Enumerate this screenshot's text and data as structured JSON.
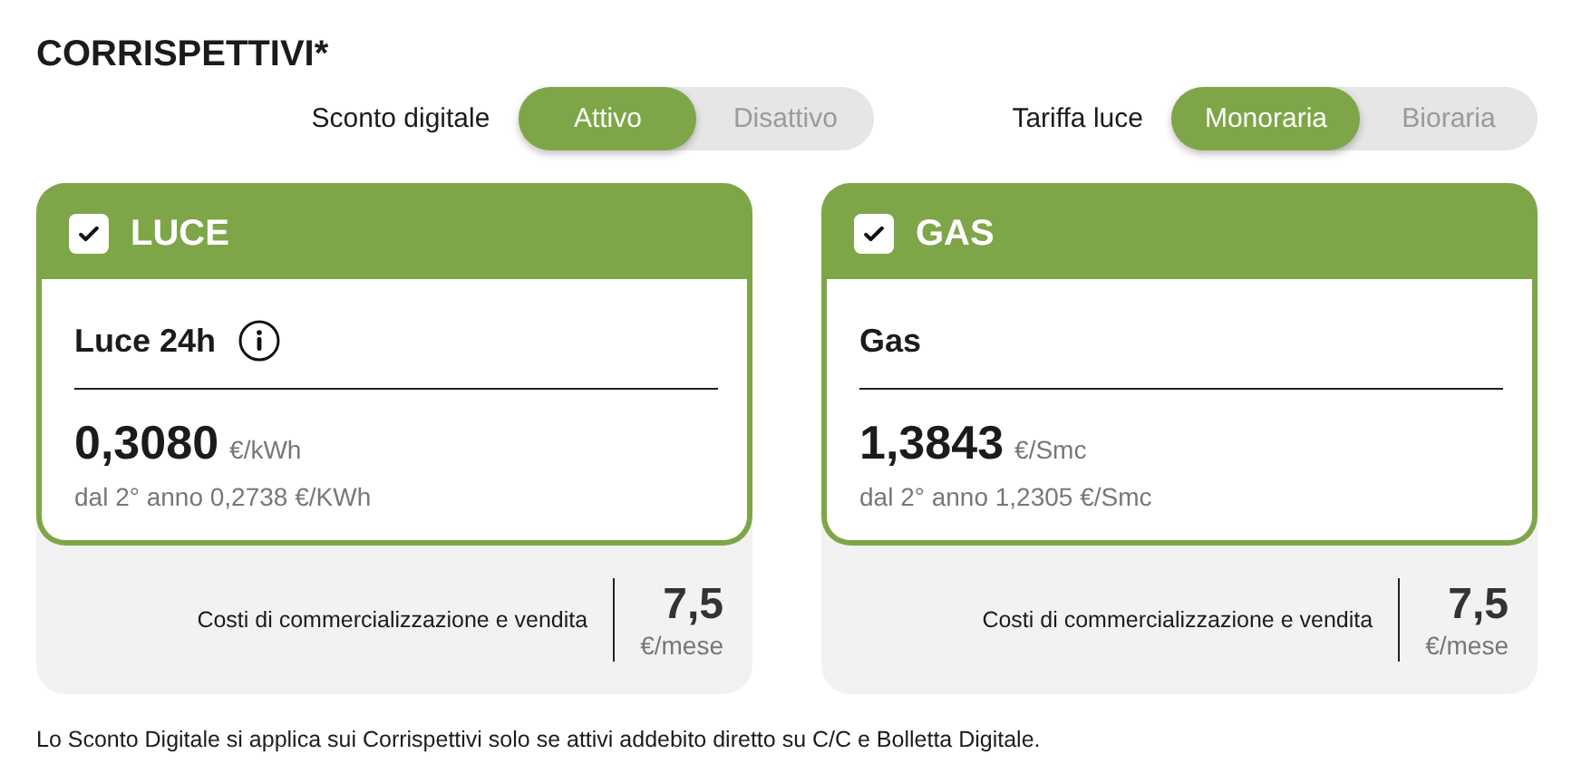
{
  "title": "CORRISPETTIVI*",
  "toggles": [
    {
      "label": "Sconto digitale",
      "options": [
        {
          "label": "Attivo",
          "selected": true
        },
        {
          "label": "Disattivo",
          "selected": false
        }
      ]
    },
    {
      "label": "Tariffa luce",
      "options": [
        {
          "label": "Monoraria",
          "selected": true
        },
        {
          "label": "Bioraria",
          "selected": false
        }
      ]
    }
  ],
  "cards": [
    {
      "title": "LUCE",
      "checked": true,
      "product": "Luce 24h",
      "info_icon": true,
      "price": "0,3080",
      "unit": "€/kWh",
      "note": "dal 2° anno 0,2738 €/KWh",
      "fee_label": "Costi di commercializzazione e vendita",
      "fee_value": "7,5",
      "fee_unit": "€/mese"
    },
    {
      "title": "GAS",
      "checked": true,
      "product": "Gas",
      "info_icon": false,
      "price": "1,3843",
      "unit": "€/Smc",
      "note": "dal 2° anno 1,2305 €/Smc",
      "fee_label": "Costi di commercializzazione e vendita",
      "fee_value": "7,5",
      "fee_unit": "€/mese"
    }
  ],
  "footnote": "Lo Sconto Digitale si applica sui Corrispettivi solo se attivi addebito diretto su C/C e Bolletta Digitale."
}
